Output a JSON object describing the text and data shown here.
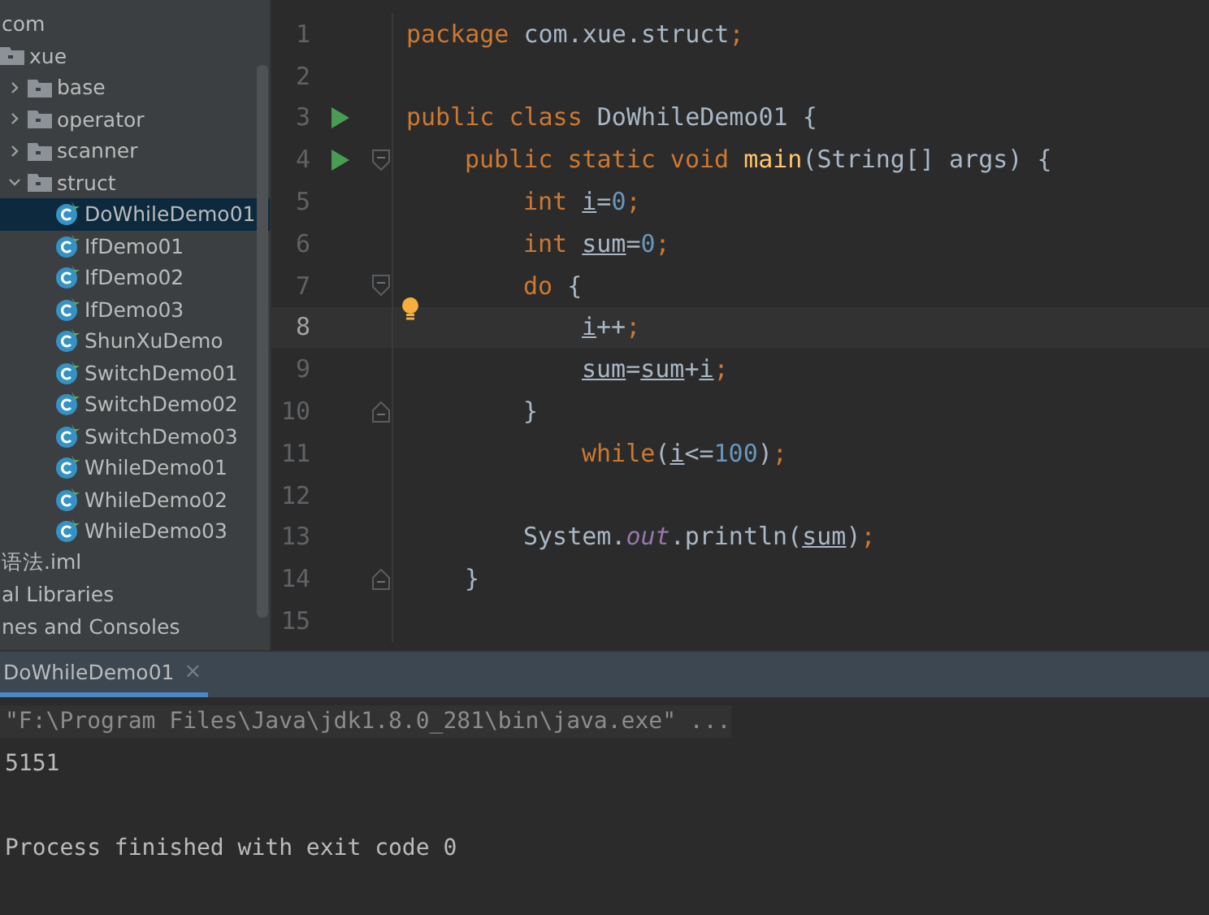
{
  "project_tree": [
    {
      "label": "com",
      "selected": false,
      "children": [
        {
          "label": "xue",
          "kind": "folder",
          "expanded": true,
          "selected": false,
          "children": [
            {
              "label": "base",
              "kind": "folder",
              "expanded": false,
              "selected": false
            },
            {
              "label": "operator",
              "kind": "folder",
              "expanded": false,
              "selected": false
            },
            {
              "label": "scanner",
              "kind": "folder",
              "expanded": false,
              "selected": false
            },
            {
              "label": "struct",
              "kind": "folder",
              "expanded": true,
              "selected": false,
              "children": [
                {
                  "label": "DoWhileDemo01",
                  "kind": "class",
                  "selected": true
                },
                {
                  "label": "IfDemo01",
                  "kind": "class",
                  "selected": false
                },
                {
                  "label": "IfDemo02",
                  "kind": "class",
                  "selected": false
                },
                {
                  "label": "IfDemo03",
                  "kind": "class",
                  "selected": false
                },
                {
                  "label": "ShunXuDemo",
                  "kind": "class",
                  "selected": false
                },
                {
                  "label": "SwitchDemo01",
                  "kind": "class",
                  "selected": false
                },
                {
                  "label": "SwitchDemo02",
                  "kind": "class",
                  "selected": false
                },
                {
                  "label": "SwitchDemo03",
                  "kind": "class",
                  "selected": false
                },
                {
                  "label": "WhileDemo01",
                  "kind": "class",
                  "selected": false
                },
                {
                  "label": "WhileDemo02",
                  "kind": "class",
                  "selected": false
                },
                {
                  "label": "WhileDemo03",
                  "kind": "class",
                  "selected": false
                }
              ]
            }
          ]
        }
      ]
    },
    {
      "label": "语法.iml",
      "selected": false
    },
    {
      "label": "al Libraries",
      "selected": false
    },
    {
      "label": "nes and Consoles",
      "selected": false
    }
  ],
  "editor": {
    "lines": [
      {
        "number": "1",
        "run": false,
        "bulb": false,
        "current": false,
        "fold_start": false,
        "fold_end": false,
        "tokens": [
          {
            "kind": "kw",
            "text": "package"
          },
          {
            "kind": "txt",
            "text": " com.xue.struct"
          },
          {
            "kind": "kw",
            "text": ";"
          }
        ]
      },
      {
        "number": "2",
        "run": false,
        "bulb": false,
        "current": false,
        "fold_start": false,
        "fold_end": false
      },
      {
        "number": "3",
        "run": true,
        "bulb": false,
        "current": false,
        "fold_start": false,
        "fold_end": false,
        "tokens": [
          {
            "kind": "kw",
            "text": "public class "
          },
          {
            "kind": "txt",
            "text": "DoWhileDemo01 {"
          }
        ],
        "children": [
          {
            "number": "4",
            "run": true,
            "bulb": false,
            "current": false,
            "fold_start": true,
            "fold_end": false,
            "tokens": [
              {
                "kind": "kw",
                "text": "public static void "
              },
              {
                "kind": "fn",
                "text": "main"
              },
              {
                "kind": "txt",
                "text": "(String[] args) {"
              }
            ],
            "children": [
              {
                "number": "5",
                "run": false,
                "bulb": false,
                "current": false,
                "fold_start": false,
                "fold_end": false,
                "tokens": [
                  {
                    "kind": "kw",
                    "text": "int "
                  },
                  {
                    "kind": "var",
                    "text": "i"
                  },
                  {
                    "kind": "txt",
                    "text": "="
                  },
                  {
                    "kind": "num",
                    "text": "0"
                  },
                  {
                    "kind": "kw",
                    "text": ";"
                  }
                ]
              },
              {
                "number": "6",
                "run": false,
                "bulb": false,
                "current": false,
                "fold_start": false,
                "fold_end": false,
                "tokens": [
                  {
                    "kind": "kw",
                    "text": "int "
                  },
                  {
                    "kind": "var",
                    "text": "sum"
                  },
                  {
                    "kind": "txt",
                    "text": "="
                  },
                  {
                    "kind": "num",
                    "text": "0"
                  },
                  {
                    "kind": "kw",
                    "text": ";"
                  }
                ]
              },
              {
                "number": "7",
                "run": false,
                "bulb": false,
                "current": false,
                "fold_start": true,
                "fold_end": false,
                "tokens": [
                  {
                    "kind": "kw",
                    "text": "do "
                  },
                  {
                    "kind": "txt",
                    "text": "{"
                  }
                ],
                "children": [
                  {
                    "number": "8",
                    "run": false,
                    "bulb": true,
                    "current": true,
                    "fold_start": false,
                    "fold_end": false,
                    "tokens": [
                      {
                        "kind": "var",
                        "text": "i"
                      },
                      {
                        "kind": "txt",
                        "text": "++"
                      },
                      {
                        "kind": "kw",
                        "text": ";"
                      }
                    ]
                  },
                  {
                    "number": "9",
                    "run": false,
                    "bulb": false,
                    "current": false,
                    "fold_start": false,
                    "fold_end": false,
                    "tokens": [
                      {
                        "kind": "var",
                        "text": "sum"
                      },
                      {
                        "kind": "txt",
                        "text": "="
                      },
                      {
                        "kind": "var",
                        "text": "sum"
                      },
                      {
                        "kind": "txt",
                        "text": "+"
                      },
                      {
                        "kind": "var",
                        "text": "i"
                      },
                      {
                        "kind": "kw",
                        "text": ";"
                      }
                    ]
                  }
                ]
              },
              {
                "number": "10",
                "run": false,
                "bulb": false,
                "current": false,
                "fold_start": false,
                "fold_end": true,
                "tokens": [
                  {
                    "kind": "txt",
                    "text": "}"
                  }
                ],
                "children": [
                  {
                    "number": "11",
                    "run": false,
                    "bulb": false,
                    "current": false,
                    "fold_start": false,
                    "fold_end": false,
                    "tokens": [
                      {
                        "kind": "kw",
                        "text": "while"
                      },
                      {
                        "kind": "txt",
                        "text": "("
                      },
                      {
                        "kind": "var",
                        "text": "i"
                      },
                      {
                        "kind": "txt",
                        "text": "<="
                      },
                      {
                        "kind": "num",
                        "text": "100"
                      },
                      {
                        "kind": "txt",
                        "text": ")"
                      },
                      {
                        "kind": "kw",
                        "text": ";"
                      }
                    ]
                  }
                ]
              },
              {
                "number": "12",
                "run": false,
                "bulb": false,
                "current": false,
                "fold_start": false,
                "fold_end": false
              },
              {
                "number": "13",
                "run": false,
                "bulb": false,
                "current": false,
                "fold_start": false,
                "fold_end": false,
                "tokens": [
                  {
                    "kind": "txt",
                    "text": "System."
                  },
                  {
                    "kind": "field",
                    "text": "out"
                  },
                  {
                    "kind": "txt",
                    "text": ".println("
                  },
                  {
                    "kind": "var",
                    "text": "sum"
                  },
                  {
                    "kind": "txt",
                    "text": ")"
                  },
                  {
                    "kind": "kw",
                    "text": ";"
                  }
                ]
              }
            ]
          },
          {
            "number": "14",
            "run": false,
            "bulb": false,
            "current": false,
            "fold_start": false,
            "fold_end": true,
            "tokens": [
              {
                "kind": "txt",
                "text": "}"
              }
            ]
          }
        ]
      },
      {
        "number": "15",
        "run": false,
        "bulb": false,
        "current": false,
        "fold_start": false,
        "fold_end": false
      }
    ]
  },
  "run_panel": {
    "tabs": [
      {
        "label": "DoWhileDemo01",
        "close": "×",
        "selected": true
      }
    ],
    "output": [
      {
        "kind": "command",
        "text": "\"F:\\Program Files\\Java\\jdk1.8.0_281\\bin\\java.exe\" ..."
      },
      {
        "kind": "stdout",
        "text": "5151"
      },
      {
        "kind": "blank"
      },
      {
        "kind": "system",
        "text": "Process finished with exit code 0"
      }
    ]
  }
}
